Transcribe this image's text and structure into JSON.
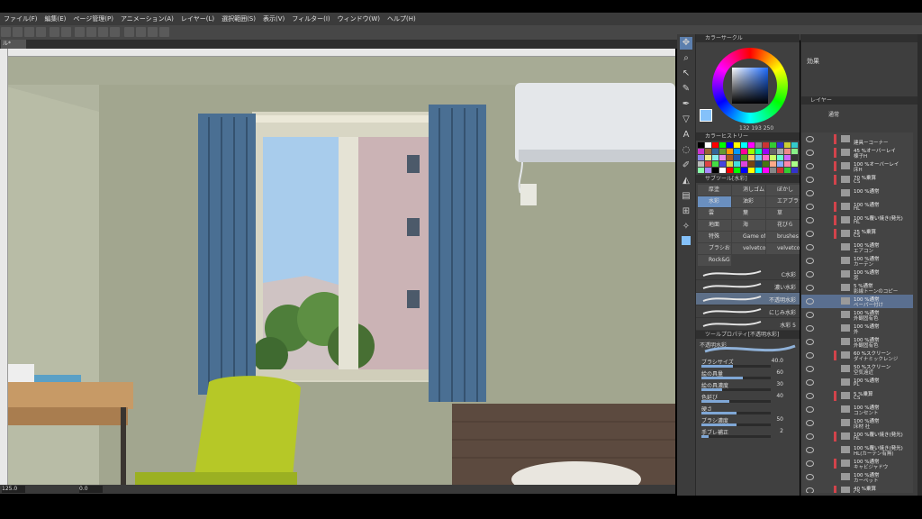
{
  "menu": [
    "ファイル(F)",
    "編集(E)",
    "ページ管理(P)",
    "アニメーション(A)",
    "レイヤー(L)",
    "選択範囲(S)",
    "表示(V)",
    "フィルター(I)",
    "ウィンドウ(W)",
    "ヘルプ(H)"
  ],
  "tab_label": "ル*",
  "status": {
    "zoom": "125.0",
    "angle": "0.0"
  },
  "panels": {
    "color_circle": "カラーサークル",
    "color_values": "132 193 250",
    "color_history": "カラーヒストリー",
    "subtool": "サブツール[水彩]",
    "tool_property": "ツールプロパティ[不透明水彩]",
    "layer_property": "効果",
    "layer": "レイヤー"
  },
  "subtool_groups": [
    "厚塗",
    "消しゴム",
    "ぼかし",
    "水彩",
    "油彩",
    "エアブラシ",
    "雲",
    "葉",
    "草",
    "地面",
    "海",
    "花びら",
    "特殊",
    "Game of",
    "brushes",
    "ブラシおまけ",
    "velvetco",
    "velvetco",
    "Rock&G"
  ],
  "subtool_selected": 3,
  "brushes": [
    "C水彩",
    "濃い水彩",
    "不透明水彩",
    "にじみ水彩",
    "水彩 5"
  ],
  "brush_selected": 2,
  "brush_preview_label": "不透明水彩",
  "props": [
    {
      "label": "ブラシサイズ",
      "value": "40.0",
      "level": 0.45
    },
    {
      "label": "絵の具量",
      "value": "60",
      "level": 0.6
    },
    {
      "label": "絵の具濃度",
      "value": "30",
      "level": 0.3
    },
    {
      "label": "色延び",
      "value": "40",
      "level": 0.4
    },
    {
      "label": "硬さ",
      "value": "",
      "level": 0.5
    },
    {
      "label": "ブラシ濃度",
      "value": "50",
      "level": 0.5
    },
    {
      "label": "手ブレ補正",
      "value": "2",
      "level": 0.1
    }
  ],
  "layer_blend": "通常",
  "layers": [
    {
      "a": "",
      "b": "建具ーコーナー",
      "m": true
    },
    {
      "a": "45 %オーバーレイ",
      "b": "棟子H",
      "m": true
    },
    {
      "a": "100 %オーバーレイ",
      "b": "床H",
      "m": true
    },
    {
      "a": "70 %乗算",
      "b": "CS",
      "m": true
    },
    {
      "a": "100 %通常",
      "b": "",
      "m": false
    },
    {
      "a": "100 %通常",
      "b": "HL",
      "m": true
    },
    {
      "a": "100 %覆い焼き(発光)",
      "b": "HL",
      "m": true
    },
    {
      "a": "25 %乗算",
      "b": "CS",
      "m": true
    },
    {
      "a": "100 %通常",
      "b": "エアコン",
      "m": false
    },
    {
      "a": "100 %通常",
      "b": "カーテン",
      "m": false
    },
    {
      "a": "100 %通常",
      "b": "窓",
      "m": false
    },
    {
      "a": "5 %通常",
      "b": "影線トーンのコピー",
      "m": false
    },
    {
      "a": "100 %通常",
      "b": "ペーパー付け",
      "m": false,
      "sel": true
    },
    {
      "a": "100 %通常",
      "b": "外観固有色",
      "m": false
    },
    {
      "a": "100 %通常",
      "b": "外",
      "m": false
    },
    {
      "a": "100 %通常",
      "b": "外観固有色",
      "m": false
    },
    {
      "a": "60 %スクリーン",
      "b": "ダイナミックレンジ",
      "m": true
    },
    {
      "a": "50 %スクリーン",
      "b": "空気遠近",
      "m": false
    },
    {
      "a": "100 %通常",
      "b": "PL",
      "m": false
    },
    {
      "a": "5 %乗算",
      "b": "CS",
      "m": true
    },
    {
      "a": "100 %通常",
      "b": "コンセント",
      "m": false
    },
    {
      "a": "100 %通常",
      "b": "床材 社",
      "m": false
    },
    {
      "a": "100 %覆い焼き(発光)",
      "b": "HL",
      "m": true
    },
    {
      "a": "100 %覆い焼き(発光)",
      "b": "HL(カーテン有無)",
      "m": false
    },
    {
      "a": "100 %通常",
      "b": "キャビジャドウ",
      "m": true
    },
    {
      "a": "100 %通常",
      "b": "カーペット",
      "m": false
    },
    {
      "a": "40 %乗算",
      "b": "CS",
      "m": true
    },
    {
      "a": "100 %通常",
      "b": "",
      "m": false
    },
    {
      "a": "100 %通常",
      "b": "",
      "m": false
    }
  ],
  "colors": {
    "wall": "#a2a68f",
    "curtain": "#4a6f93",
    "sky": "#a8ccec",
    "chair": "#b6c827",
    "accent": "#84c1fa"
  }
}
